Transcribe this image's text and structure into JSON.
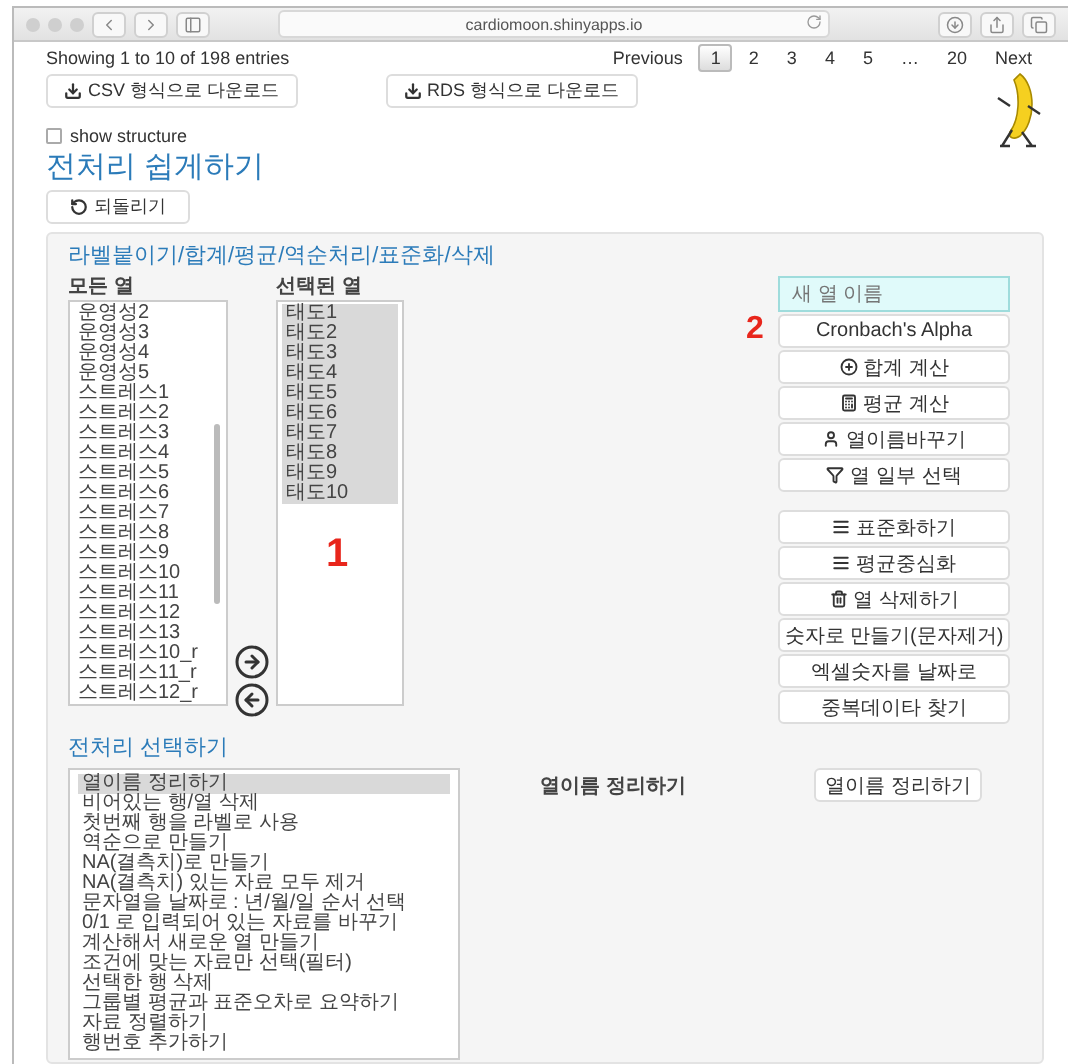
{
  "browser": {
    "url": "cardiomoon.shinyapps.io"
  },
  "table_info": "Showing 1 to 10 of 198 entries",
  "pagination": [
    {
      "label": "Previous",
      "selected": false
    },
    {
      "label": "1",
      "selected": true
    },
    {
      "label": "2",
      "selected": false
    },
    {
      "label": "3",
      "selected": false
    },
    {
      "label": "4",
      "selected": false
    },
    {
      "label": "5",
      "selected": false
    },
    {
      "label": "…",
      "selected": false
    },
    {
      "label": "20",
      "selected": false
    },
    {
      "label": "Next",
      "selected": false
    }
  ],
  "downloads": [
    {
      "label": "CSV 형식으로 다운로드"
    },
    {
      "label": "RDS 형식으로 다운로드"
    }
  ],
  "show_structure": {
    "label": "show structure",
    "checked": false
  },
  "title": "전처리 쉽게하기",
  "undo_button": "되돌리기",
  "panel": {
    "heading": "라벨붙이기/합계/평균/역순처리/표준화/삭제",
    "all_columns": {
      "label": "모든 열",
      "items": [
        {
          "label": "운영성2",
          "selected": false
        },
        {
          "label": "운영성3",
          "selected": false
        },
        {
          "label": "운영성4",
          "selected": false
        },
        {
          "label": "운영성5",
          "selected": false
        },
        {
          "label": "스트레스1",
          "selected": false
        },
        {
          "label": "스트레스2",
          "selected": false
        },
        {
          "label": "스트레스3",
          "selected": false
        },
        {
          "label": "스트레스4",
          "selected": false
        },
        {
          "label": "스트레스5",
          "selected": false
        },
        {
          "label": "스트레스6",
          "selected": false
        },
        {
          "label": "스트레스7",
          "selected": false
        },
        {
          "label": "스트레스8",
          "selected": false
        },
        {
          "label": "스트레스9",
          "selected": false
        },
        {
          "label": "스트레스10",
          "selected": false
        },
        {
          "label": "스트레스11",
          "selected": false
        },
        {
          "label": "스트레스12",
          "selected": false
        },
        {
          "label": "스트레스13",
          "selected": false
        },
        {
          "label": "스트레스10_r",
          "selected": false
        },
        {
          "label": "스트레스11_r",
          "selected": false
        },
        {
          "label": "스트레스12_r",
          "selected": false
        }
      ]
    },
    "selected_columns": {
      "label": "선택된 열",
      "items": [
        {
          "label": "태도1",
          "selected": true
        },
        {
          "label": "태도2",
          "selected": true
        },
        {
          "label": "태도3",
          "selected": true
        },
        {
          "label": "태도4",
          "selected": true
        },
        {
          "label": "태도5",
          "selected": true
        },
        {
          "label": "태도6",
          "selected": true
        },
        {
          "label": "태도7",
          "selected": true
        },
        {
          "label": "태도8",
          "selected": true
        },
        {
          "label": "태도9",
          "selected": true
        },
        {
          "label": "태도10",
          "selected": true
        }
      ]
    },
    "new_name": {
      "placeholder": "새 열 이름"
    },
    "actions": [
      {
        "label": "Cronbach's Alpha",
        "kind": "plain"
      },
      {
        "label": "합계 계산",
        "kind": "plus"
      },
      {
        "label": "평균 계산",
        "kind": "calculator"
      },
      {
        "label": "열이름바꾸기",
        "kind": "user"
      },
      {
        "label": "열 일부 선택",
        "kind": "filter"
      }
    ],
    "transforms": [
      {
        "label": "표준화하기",
        "kind": "list"
      },
      {
        "label": "평균중심화",
        "kind": "list"
      },
      {
        "label": "열 삭제하기",
        "kind": "trash"
      },
      {
        "label": "숫자로 만들기(문자제거)",
        "kind": "plain"
      },
      {
        "label": "엑셀숫자를 날짜로",
        "kind": "plain"
      },
      {
        "label": "중복데이타 찾기",
        "kind": "plain"
      }
    ],
    "annotations": [
      "1",
      "2"
    ]
  },
  "preprocess": {
    "heading": "전처리 선택하기",
    "options": [
      {
        "label": "열이름 정리하기",
        "selected": true
      },
      {
        "label": "비어있는 행/열 삭제",
        "selected": false
      },
      {
        "label": "첫번째 행을 라벨로 사용",
        "selected": false
      },
      {
        "label": "역순으로 만들기",
        "selected": false
      },
      {
        "label": "NA(결측치)로 만들기",
        "selected": false
      },
      {
        "label": "NA(결측치) 있는 자료 모두 제거",
        "selected": false
      },
      {
        "label": "문자열을 날짜로 : 년/월/일 순서 선택",
        "selected": false
      },
      {
        "label": "0/1 로 입력되어 있는 자료를 바꾸기",
        "selected": false
      },
      {
        "label": "계산해서 새로운 열 만들기",
        "selected": false
      },
      {
        "label": "조건에 맞는 자료만 선택(필터)",
        "selected": false
      },
      {
        "label": "선택한 행 삭제",
        "selected": false
      },
      {
        "label": "그룹별 평균과 표준오차로 요약하기",
        "selected": false
      },
      {
        "label": "자료 정렬하기",
        "selected": false
      },
      {
        "label": "행번호 추가하기",
        "selected": false
      }
    ],
    "current": "열이름 정리하기",
    "button": "열이름 정리하기"
  }
}
